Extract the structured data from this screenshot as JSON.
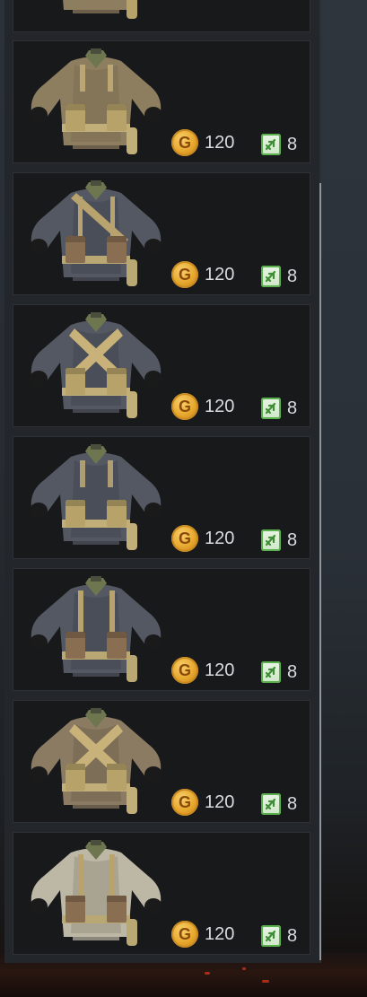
{
  "items": [
    {
      "name": "",
      "cloth": "#8e7e60",
      "vest": "#857558",
      "straps": "#c7b27a",
      "pouch": "#b7a36a",
      "belt": "#c2ae78",
      "style": "sweater",
      "gold": "120",
      "tickets": "8"
    },
    {
      "name": "",
      "cloth": "#545862",
      "vest": "#4a4e58",
      "straps": "#b8a26e",
      "pouch": "#8a6e52",
      "belt": "#b9a774",
      "style": "sling",
      "gold": "120",
      "tickets": "8"
    },
    {
      "name": "",
      "cloth": "#545862",
      "vest": "#4a4e58",
      "straps": "#c9b279",
      "pouch": "#b7a36a",
      "belt": "#c2ae78",
      "style": "cross",
      "gold": "120",
      "tickets": "8"
    },
    {
      "name": "",
      "cloth": "#545862",
      "vest": "#4a4e58",
      "straps": "#c7b27a",
      "pouch": "#b7a36a",
      "belt": "#c2ae78",
      "style": "sweater",
      "gold": "120",
      "tickets": "8"
    },
    {
      "name": "",
      "cloth": "#545862",
      "vest": "#4a4e58",
      "straps": "#b8a26e",
      "pouch": "#8a6e52",
      "belt": "#b9a774",
      "style": "suspenders",
      "gold": "120",
      "tickets": "8"
    },
    {
      "name": "",
      "cloth": "#8a7b62",
      "vest": "#7d6f57",
      "straps": "#c9b279",
      "pouch": "#b7a36a",
      "belt": "#c2ae78",
      "style": "cross",
      "gold": "120",
      "tickets": "8"
    },
    {
      "name": "",
      "cloth": "#bdb7a6",
      "vest": "#a9a392",
      "straps": "#b8a26e",
      "pouch": "#8a6e52",
      "belt": "#b9a774",
      "style": "suspenders",
      "gold": "120",
      "tickets": "8"
    }
  ],
  "partial_item": {
    "cloth": "#8e7e60",
    "pouch": "#b7a36a"
  },
  "icons": {
    "currency": "gold-coin-icon",
    "ticket": "green-ticket-icon"
  },
  "colors": {
    "coin": "#e6a52a",
    "ticket": "#5bb04e",
    "text": "#d9dcdf"
  }
}
